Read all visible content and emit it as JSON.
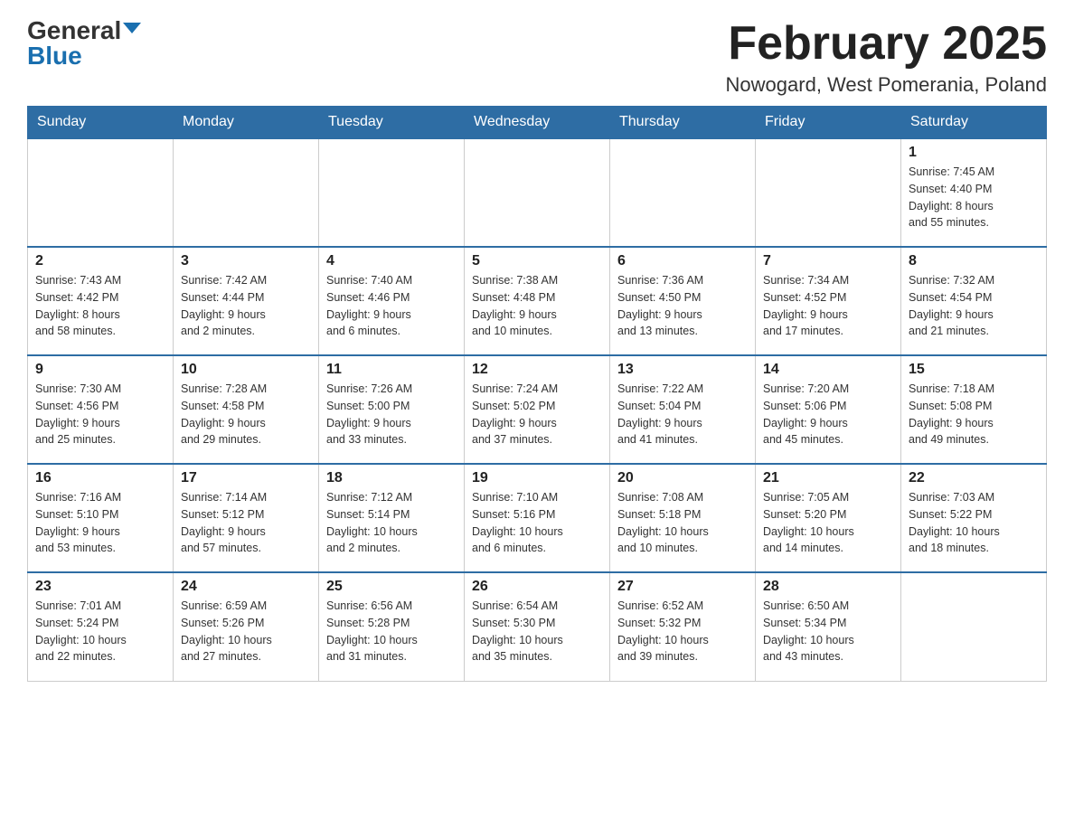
{
  "header": {
    "logo_general": "General",
    "logo_blue": "Blue",
    "month_title": "February 2025",
    "location": "Nowogard, West Pomerania, Poland"
  },
  "weekdays": [
    "Sunday",
    "Monday",
    "Tuesday",
    "Wednesday",
    "Thursday",
    "Friday",
    "Saturday"
  ],
  "weeks": [
    [
      {
        "day": "",
        "info": ""
      },
      {
        "day": "",
        "info": ""
      },
      {
        "day": "",
        "info": ""
      },
      {
        "day": "",
        "info": ""
      },
      {
        "day": "",
        "info": ""
      },
      {
        "day": "",
        "info": ""
      },
      {
        "day": "1",
        "info": "Sunrise: 7:45 AM\nSunset: 4:40 PM\nDaylight: 8 hours\nand 55 minutes."
      }
    ],
    [
      {
        "day": "2",
        "info": "Sunrise: 7:43 AM\nSunset: 4:42 PM\nDaylight: 8 hours\nand 58 minutes."
      },
      {
        "day": "3",
        "info": "Sunrise: 7:42 AM\nSunset: 4:44 PM\nDaylight: 9 hours\nand 2 minutes."
      },
      {
        "day": "4",
        "info": "Sunrise: 7:40 AM\nSunset: 4:46 PM\nDaylight: 9 hours\nand 6 minutes."
      },
      {
        "day": "5",
        "info": "Sunrise: 7:38 AM\nSunset: 4:48 PM\nDaylight: 9 hours\nand 10 minutes."
      },
      {
        "day": "6",
        "info": "Sunrise: 7:36 AM\nSunset: 4:50 PM\nDaylight: 9 hours\nand 13 minutes."
      },
      {
        "day": "7",
        "info": "Sunrise: 7:34 AM\nSunset: 4:52 PM\nDaylight: 9 hours\nand 17 minutes."
      },
      {
        "day": "8",
        "info": "Sunrise: 7:32 AM\nSunset: 4:54 PM\nDaylight: 9 hours\nand 21 minutes."
      }
    ],
    [
      {
        "day": "9",
        "info": "Sunrise: 7:30 AM\nSunset: 4:56 PM\nDaylight: 9 hours\nand 25 minutes."
      },
      {
        "day": "10",
        "info": "Sunrise: 7:28 AM\nSunset: 4:58 PM\nDaylight: 9 hours\nand 29 minutes."
      },
      {
        "day": "11",
        "info": "Sunrise: 7:26 AM\nSunset: 5:00 PM\nDaylight: 9 hours\nand 33 minutes."
      },
      {
        "day": "12",
        "info": "Sunrise: 7:24 AM\nSunset: 5:02 PM\nDaylight: 9 hours\nand 37 minutes."
      },
      {
        "day": "13",
        "info": "Sunrise: 7:22 AM\nSunset: 5:04 PM\nDaylight: 9 hours\nand 41 minutes."
      },
      {
        "day": "14",
        "info": "Sunrise: 7:20 AM\nSunset: 5:06 PM\nDaylight: 9 hours\nand 45 minutes."
      },
      {
        "day": "15",
        "info": "Sunrise: 7:18 AM\nSunset: 5:08 PM\nDaylight: 9 hours\nand 49 minutes."
      }
    ],
    [
      {
        "day": "16",
        "info": "Sunrise: 7:16 AM\nSunset: 5:10 PM\nDaylight: 9 hours\nand 53 minutes."
      },
      {
        "day": "17",
        "info": "Sunrise: 7:14 AM\nSunset: 5:12 PM\nDaylight: 9 hours\nand 57 minutes."
      },
      {
        "day": "18",
        "info": "Sunrise: 7:12 AM\nSunset: 5:14 PM\nDaylight: 10 hours\nand 2 minutes."
      },
      {
        "day": "19",
        "info": "Sunrise: 7:10 AM\nSunset: 5:16 PM\nDaylight: 10 hours\nand 6 minutes."
      },
      {
        "day": "20",
        "info": "Sunrise: 7:08 AM\nSunset: 5:18 PM\nDaylight: 10 hours\nand 10 minutes."
      },
      {
        "day": "21",
        "info": "Sunrise: 7:05 AM\nSunset: 5:20 PM\nDaylight: 10 hours\nand 14 minutes."
      },
      {
        "day": "22",
        "info": "Sunrise: 7:03 AM\nSunset: 5:22 PM\nDaylight: 10 hours\nand 18 minutes."
      }
    ],
    [
      {
        "day": "23",
        "info": "Sunrise: 7:01 AM\nSunset: 5:24 PM\nDaylight: 10 hours\nand 22 minutes."
      },
      {
        "day": "24",
        "info": "Sunrise: 6:59 AM\nSunset: 5:26 PM\nDaylight: 10 hours\nand 27 minutes."
      },
      {
        "day": "25",
        "info": "Sunrise: 6:56 AM\nSunset: 5:28 PM\nDaylight: 10 hours\nand 31 minutes."
      },
      {
        "day": "26",
        "info": "Sunrise: 6:54 AM\nSunset: 5:30 PM\nDaylight: 10 hours\nand 35 minutes."
      },
      {
        "day": "27",
        "info": "Sunrise: 6:52 AM\nSunset: 5:32 PM\nDaylight: 10 hours\nand 39 minutes."
      },
      {
        "day": "28",
        "info": "Sunrise: 6:50 AM\nSunset: 5:34 PM\nDaylight: 10 hours\nand 43 minutes."
      },
      {
        "day": "",
        "info": ""
      }
    ]
  ]
}
